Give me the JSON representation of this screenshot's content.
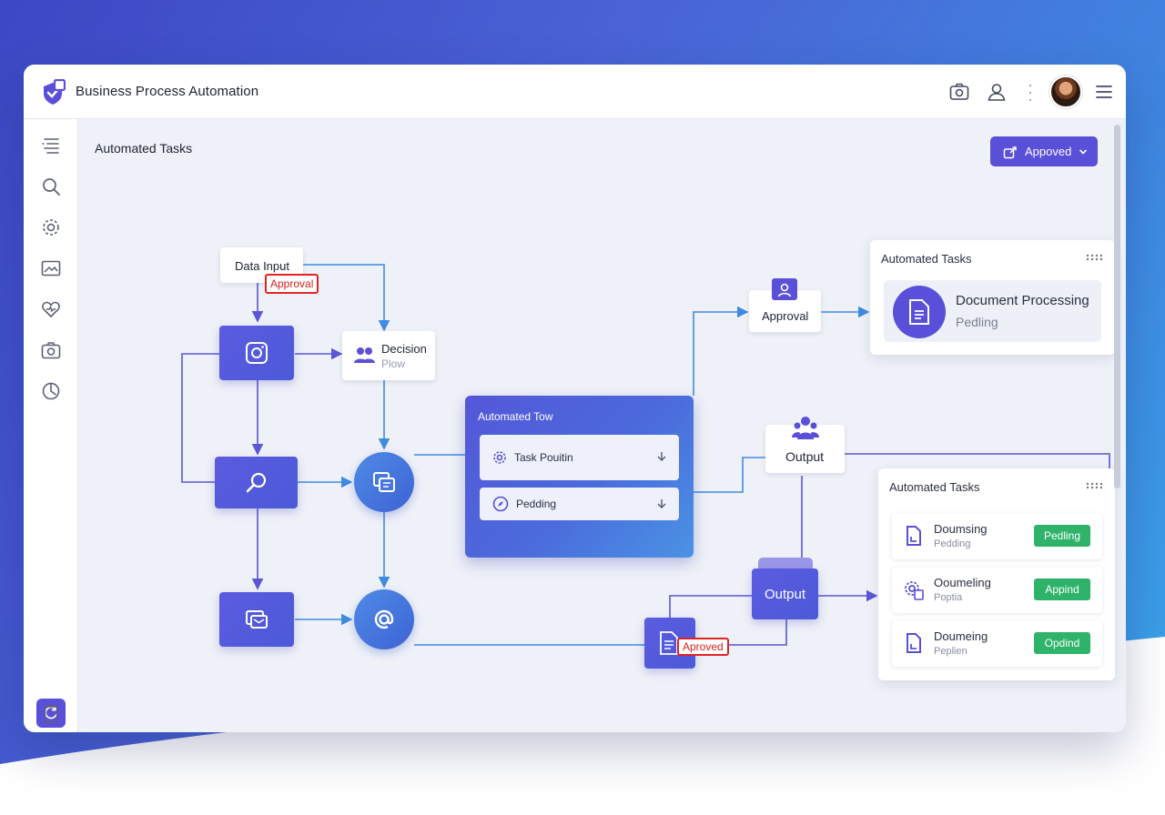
{
  "app": {
    "title": "Business Process Automation"
  },
  "canvas": {
    "title": "Automated Tasks"
  },
  "approved_button": {
    "label": "Appoved"
  },
  "flow": {
    "data_input": "Data Input",
    "approval_tag_top": "Approval",
    "decision_title": "Decision",
    "decision_sub": "Plow",
    "approval_node": "Approval",
    "output_node_top": "Output",
    "output_node_main": "Output",
    "approved_tag_bottom": "Aproved"
  },
  "blue_panel": {
    "title": "Automated Tow",
    "rows": [
      {
        "label": "Task Pouitin"
      },
      {
        "label": "Pedding"
      }
    ]
  },
  "tasks_top": {
    "title": "Automated Tasks",
    "doc_title": "Document Processing",
    "doc_status": "Pedling"
  },
  "tasks_bottom": {
    "title": "Automated Tasks",
    "items": [
      {
        "name": "Doumsing",
        "status": "Pedding",
        "badge": "Pedling"
      },
      {
        "name": "Ooumeling",
        "status": "Poptia",
        "badge": "Appind"
      },
      {
        "name": "Doumeing",
        "status": "Peplien",
        "badge": "Opdind"
      }
    ]
  },
  "colors": {
    "accent": "#5a4fd8",
    "node_blue": "#3d63d4",
    "badge_green": "#2fb36a",
    "tag_red": "#e02424"
  },
  "icons": {
    "brand": "shield-check-icon",
    "top": [
      "camera-icon",
      "user-icon",
      "more-vertical-icon",
      "menu-icon"
    ],
    "sidebar": [
      "list-icon",
      "search-icon",
      "settings-icon",
      "image-icon",
      "heart-icon",
      "camera-icon",
      "chart-icon",
      "sync-icon",
      "clipboard-icon"
    ]
  }
}
